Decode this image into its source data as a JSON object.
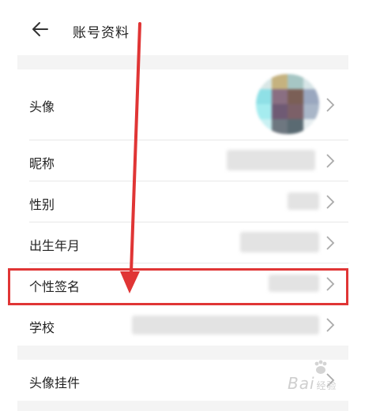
{
  "header": {
    "title": "账号资料",
    "back_icon": "arrow-left-icon"
  },
  "rows": [
    {
      "label": "头像"
    },
    {
      "label": "昵称"
    },
    {
      "label": "性别"
    },
    {
      "label": "出生年月"
    },
    {
      "label": "个性签名"
    },
    {
      "label": "学校"
    },
    {
      "label": "头像挂件"
    }
  ],
  "annotation": {
    "highlight_color": "#e03535",
    "highlighted_row": "个性签名"
  },
  "watermark": {
    "text": "Bai",
    "text2": "经验",
    "color": "#cfcfcf"
  },
  "colors": {
    "background": "#f4f4f4",
    "row_background": "#ffffff",
    "chevron": "#aaaaaa"
  }
}
